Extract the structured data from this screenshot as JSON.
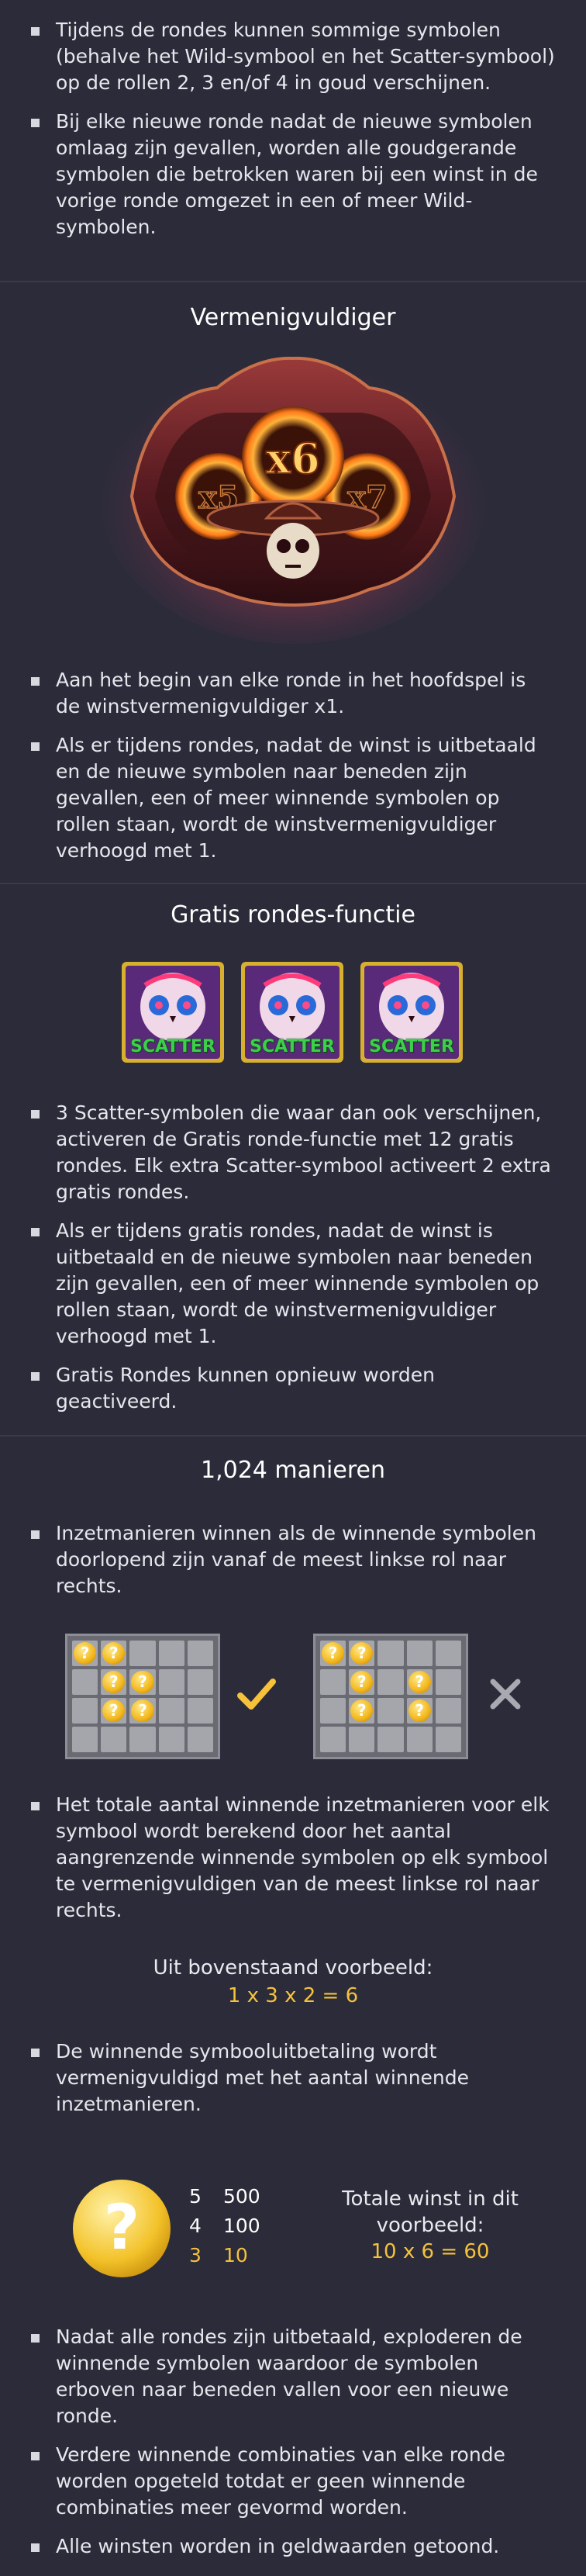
{
  "section_wild": {
    "bullets": [
      "Tijdens de rondes kunnen sommige symbolen (behalve het Wild-symbool en het Scatter-symbool) op de rollen 2, 3 en/of 4 in goud verschijnen.",
      "Bij elke nieuwe ronde nadat de nieuwe symbolen omlaag zijn gevallen, worden alle goudgerande symbolen die betrokken waren bij een winst in de vorige ronde omgezet in een of meer Wild-symbolen."
    ]
  },
  "section_multiplier": {
    "title": "Vermenigvuldiger",
    "badge_left": "x5",
    "badge_center": "x6",
    "badge_right": "x7",
    "bullets": [
      "Aan het begin van elke ronde in het hoofdspel is de winstvermenigvuldiger x1.",
      "Als er tijdens rondes, nadat de winst is uitbetaald en de nieuwe symbolen naar beneden zijn gevallen, een of meer winnende symbolen op rollen staan, wordt de winstvermenigvuldiger verhoogd met 1."
    ]
  },
  "section_free": {
    "title": "Gratis rondes-functie",
    "scatter_label": "SCATTER",
    "bullets": [
      "3 Scatter-symbolen die waar dan ook verschijnen, activeren de Gratis ronde-functie met 12 gratis rondes. Elk extra Scatter-symbool activeert 2 extra gratis rondes.",
      "Als er tijdens gratis rondes, nadat de winst is uitbetaald en de nieuwe symbolen naar beneden zijn gevallen, een of meer winnende symbolen op rollen staan, wordt de winstvermenigvuldiger verhoogd met 1.",
      "Gratis Rondes kunnen opnieuw worden geactiveerd."
    ]
  },
  "section_ways": {
    "title": "1,024 manieren",
    "bullet_intro": "Inzetmanieren winnen als de winnende symbolen doorlopend zijn vanaf de meest linkse rol naar rechts.",
    "coin_glyph": "?",
    "check_icon": "check-icon",
    "cross_icon": "cross-icon",
    "bullet_total": "Het totale aantal winnende inzetmanieren voor elk symbool wordt berekend door het aantal aangrenzende winnende symbolen op elk symbool te vermenigvuldigen van de meest linkse rol naar rechts.",
    "example_heading": "Uit bovenstaand voorbeeld:",
    "example_formula": "1 x 3 x 2 = 6",
    "bullet_payout": "De winnende symbooluitbetaling wordt vermenigvuldigd met het aantal winnende inzetmanieren.",
    "paytable": [
      {
        "count": "5",
        "value": "500",
        "highlight": false
      },
      {
        "count": "4",
        "value": "100",
        "highlight": false
      },
      {
        "count": "3",
        "value": "10",
        "highlight": true
      }
    ],
    "total_label_line1": "Totale winst in dit",
    "total_label_line2": "voorbeeld:",
    "total_formula": "10 x 6 = 60",
    "bullets_end": [
      "Nadat alle rondes zijn uitbetaald, exploderen de winnende symbolen waardoor de symbolen erboven naar beneden vallen voor een nieuwe ronde.",
      "Verdere winnende combinaties van elke ronde worden opgeteld totdat er geen winnende combinaties meer gevormd worden.",
      "Alle winsten worden in geldwaarden getoond."
    ]
  },
  "colors": {
    "background": "#2b2b3a",
    "accent_gold": "#f5c23a",
    "divider": "#3a3a4b"
  }
}
